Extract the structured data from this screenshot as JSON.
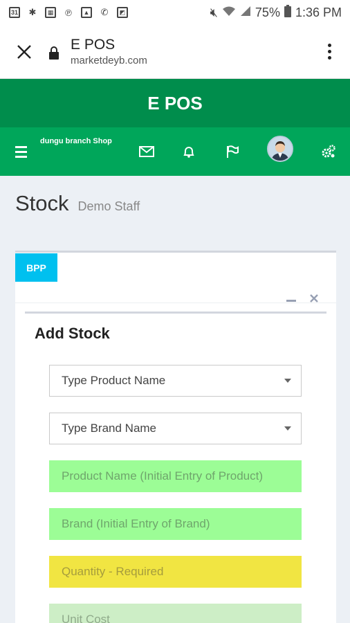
{
  "status_bar": {
    "left_icons": [
      "calendar-icon",
      "slack-icon",
      "calendar-grid-icon",
      "pinterest-icon",
      "gallery-icon",
      "whatsapp-icon",
      "flipboard-icon"
    ],
    "battery": "75%",
    "time": "1:36 PM"
  },
  "browser": {
    "title": "E POS",
    "domain": "marketdeyb.com"
  },
  "app": {
    "title": "E POS",
    "shop_name": "dungu branch Shop"
  },
  "page": {
    "title": "Stock",
    "subtitle": "Demo Staff",
    "badge": "BPP"
  },
  "form": {
    "title": "Add Stock",
    "product_select": "Type Product Name",
    "brand_select": "Type Brand Name",
    "product_name_placeholder": "Product Name (Initial Entry of Product)",
    "brand_placeholder": "Brand (Initial Entry of Brand)",
    "quantity_placeholder": "Quantity - Required",
    "unit_cost_placeholder": "Unit Cost"
  },
  "colors": {
    "header_dark": "#008d4c",
    "header": "#00a65a",
    "badge": "#00c0ef",
    "field_green": "#9cfd96",
    "field_yellow": "#f1e542"
  }
}
